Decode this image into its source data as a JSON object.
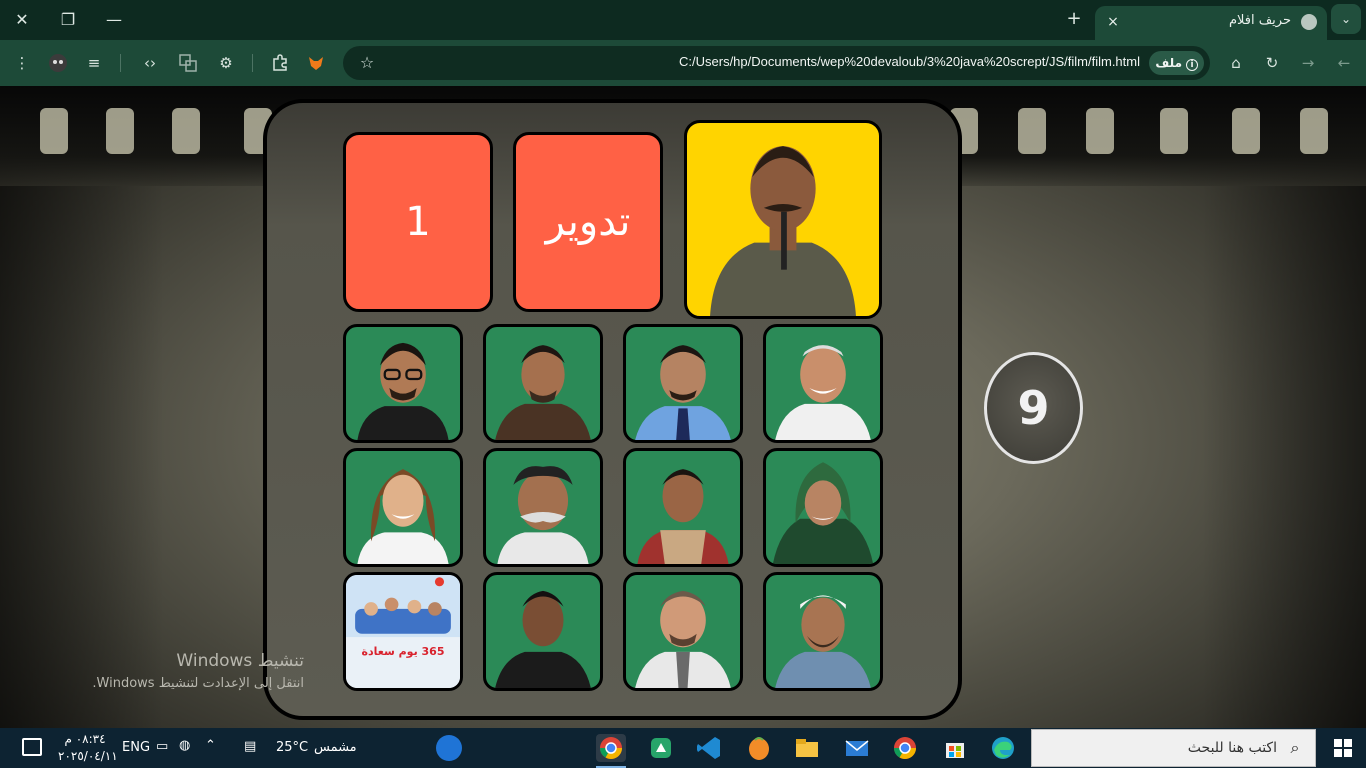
{
  "browser": {
    "tab_title": "حريف افلام",
    "tab_close": "×",
    "new_tab": "+",
    "window_close": "✕",
    "window_restore": "❐",
    "window_minimize": "—",
    "address_chip": "ملف",
    "url": "C:/Users/hp/Documents/wep%20devaloub/3%20java%20scrept/JS/film/film.html",
    "icons": [
      "menu-icon",
      "extension-avatar-icon",
      "media-control-icon",
      "devtools-icon",
      "translate-icon",
      "vpn-icon",
      "extensions-icon",
      "fox-icon",
      "bookmark-star-icon",
      "home-icon",
      "reload-icon",
      "back-icon",
      "forward-icon"
    ]
  },
  "game": {
    "counter_button": "1",
    "rotate_button": "تدوير",
    "score": "9",
    "cards": [
      "actor-1",
      "actor-2",
      "actor-3",
      "actor-4",
      "actor-5",
      "actor-6",
      "actor-7",
      "actor-8",
      "poster-365",
      "actor-10",
      "actor-11",
      "actor-12"
    ],
    "poster_text": "365 يوم سعادة"
  },
  "overlay": {
    "activate_title": "تنشيط Windows",
    "activate_sub": "انتقل إلى الإعدادت لتنشيط Windows."
  },
  "taskbar": {
    "search_placeholder": "اكتب هنا للبحث",
    "weather_temp": "25°C",
    "weather_label": "مشمس",
    "language": "ENG",
    "time": "٠٨:٣٤ م",
    "date": "٢٠٢٥/٠٤/١١"
  }
}
